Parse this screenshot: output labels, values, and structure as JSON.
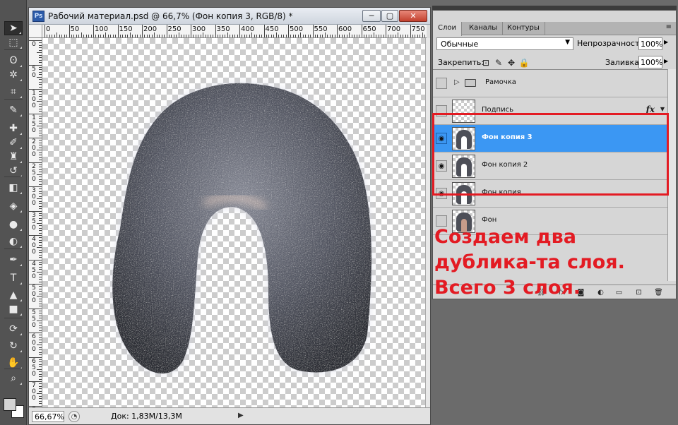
{
  "document": {
    "title": "Рабочий материал.psd @ 66,7% (Фон копия 3, RGB/8) *",
    "app_badge": "Ps",
    "window_buttons": {
      "minimize": "─",
      "restore": "▢",
      "close": "✕"
    },
    "ruler_top_labels": [
      "0",
      "50",
      "100",
      "150",
      "200",
      "250",
      "300",
      "350",
      "400",
      "450",
      "500",
      "550",
      "600",
      "650",
      "700",
      "750"
    ],
    "ruler_left_labels": [
      "0",
      "50",
      "100",
      "150",
      "200",
      "250",
      "300",
      "350",
      "400",
      "450",
      "500",
      "550",
      "600",
      "650",
      "700",
      "750"
    ],
    "status": {
      "zoom": "66,67%",
      "doc_size": "Док: 1,83M/13,3M",
      "arrow": "▶"
    }
  },
  "toolbar": {
    "tools": [
      {
        "name": "move-tool",
        "glyph": "➤"
      },
      {
        "name": "marquee-tool",
        "glyph": "⬚"
      },
      {
        "name": "lasso-tool",
        "glyph": "ʘ"
      },
      {
        "name": "magic-wand-tool",
        "glyph": "✲"
      },
      {
        "name": "crop-tool",
        "glyph": "⌗"
      },
      {
        "name": "eyedropper-tool",
        "glyph": "✎"
      },
      {
        "name": "healing-brush-tool",
        "glyph": "✚"
      },
      {
        "name": "brush-tool",
        "glyph": "✐"
      },
      {
        "name": "clone-stamp-tool",
        "glyph": "♜"
      },
      {
        "name": "history-brush-tool",
        "glyph": "↺"
      },
      {
        "name": "eraser-tool",
        "glyph": "◧"
      },
      {
        "name": "paint-bucket-tool",
        "glyph": "◈"
      },
      {
        "name": "blur-tool",
        "glyph": "●"
      },
      {
        "name": "dodge-tool",
        "glyph": "◐"
      },
      {
        "name": "pen-tool",
        "glyph": "✒"
      },
      {
        "name": "type-tool",
        "glyph": "T"
      },
      {
        "name": "path-selection-tool",
        "glyph": "▲"
      },
      {
        "name": "shape-tool",
        "glyph": "■"
      },
      {
        "name": "3d-rotate-tool",
        "glyph": "⟳"
      },
      {
        "name": "3d-orbit-tool",
        "glyph": "↻"
      },
      {
        "name": "hand-tool",
        "glyph": "✋"
      },
      {
        "name": "zoom-tool",
        "glyph": "⌕"
      }
    ],
    "colors": {
      "foreground": "#d4d4d4",
      "background": "#ffffff"
    }
  },
  "layers_panel": {
    "tabs": [
      "Слои",
      "Каналы",
      "Контуры"
    ],
    "menu_icon": "≡",
    "blend_mode": "Обычные",
    "opacity_label": "Непрозрачность:",
    "opacity_value": "100%",
    "lock_label": "Закрепить:",
    "fill_label": "Заливка:",
    "fill_value": "100%",
    "layers": [
      {
        "name": "Рамочка",
        "type": "group",
        "visible": false,
        "selected": false
      },
      {
        "name": "Подпись",
        "type": "layer",
        "visible": false,
        "selected": false,
        "fx": "fx"
      },
      {
        "name": "Фон копия 3",
        "type": "layer",
        "visible": true,
        "selected": true
      },
      {
        "name": "Фон копия 2",
        "type": "layer",
        "visible": true,
        "selected": false
      },
      {
        "name": "Фон копия",
        "type": "layer",
        "visible": true,
        "selected": false
      },
      {
        "name": "Фон",
        "type": "layer",
        "visible": false,
        "selected": false
      }
    ],
    "bottom_icons": [
      "link-layers-icon",
      "fx-icon",
      "layer-mask-icon",
      "adjustment-layer-icon",
      "new-group-icon",
      "new-layer-icon",
      "delete-layer-icon"
    ],
    "bottom_glyphs": [
      "⛓",
      "fx",
      "◙",
      "◐",
      "▭",
      "⊡",
      "🗑"
    ]
  },
  "annotation": {
    "text": "Создаем два дублика-та слоя. Всего 3 слоя.",
    "color": "#e31b23"
  }
}
